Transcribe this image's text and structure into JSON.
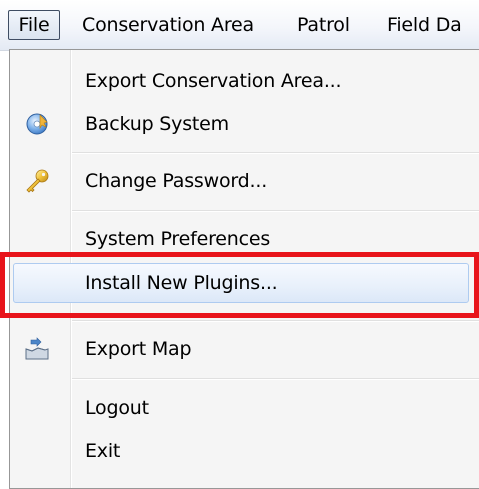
{
  "menubar": {
    "items": [
      "File",
      "Conservation Area",
      "Patrol",
      "Field Da"
    ]
  },
  "file_menu": {
    "items": [
      {
        "label": "Export Conservation Area...",
        "icon": ""
      },
      {
        "label": "Backup System",
        "icon": "backup-disc-icon"
      },
      {
        "label": "Change Password...",
        "icon": "key-icon"
      },
      {
        "label": "System Preferences",
        "icon": ""
      },
      {
        "label": "Install New Plugins...",
        "icon": "",
        "state": "highlighted"
      },
      {
        "label": "Export Map",
        "icon": "export-map-icon"
      },
      {
        "label": "Logout",
        "icon": ""
      },
      {
        "label": "Exit",
        "icon": ""
      }
    ]
  },
  "annotation": {
    "color": "#e8141b"
  }
}
